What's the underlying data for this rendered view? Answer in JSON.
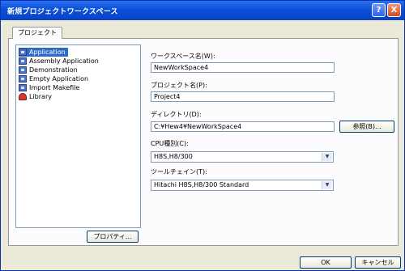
{
  "window": {
    "title": "新規プロジェクトワークスペース",
    "help_glyph": "?",
    "close_glyph": "X"
  },
  "tabs": [
    {
      "label": "プロジェクト"
    }
  ],
  "project_types": [
    {
      "label": "Application",
      "icon": "project-icon",
      "selected": true
    },
    {
      "label": "Assembly Application",
      "icon": "project-icon",
      "selected": false
    },
    {
      "label": "Demonstration",
      "icon": "project-icon",
      "selected": false
    },
    {
      "label": "Empty Application",
      "icon": "project-icon",
      "selected": false
    },
    {
      "label": "Import Makefile",
      "icon": "project-icon",
      "selected": false
    },
    {
      "label": "Library",
      "icon": "library-icon",
      "selected": false
    }
  ],
  "form": {
    "workspace_name_label": "ワークスペース名(W):",
    "workspace_name_value": "NewWorkSpace4",
    "project_name_label": "プロジェクト名(P):",
    "project_name_value": "Project4",
    "directory_label": "ディレクトリ(D):",
    "directory_value": "C:¥Hew4¥NewWorkSpace4",
    "browse_label": "参照(B)...",
    "cpu_label": "CPU種別(C):",
    "cpu_value": "H8S,H8/300",
    "toolchain_label": "ツールチェイン(T):",
    "toolchain_value": "Hitachi H8S,H8/300 Standard"
  },
  "buttons": {
    "properties_label": "プロパティ...",
    "ok_label": "OK",
    "cancel_label": "キャンセル"
  },
  "colors": {
    "titlebar": "#0b4fd8",
    "selection": "#316ac5",
    "dialog_bg": "#ece9d8"
  }
}
